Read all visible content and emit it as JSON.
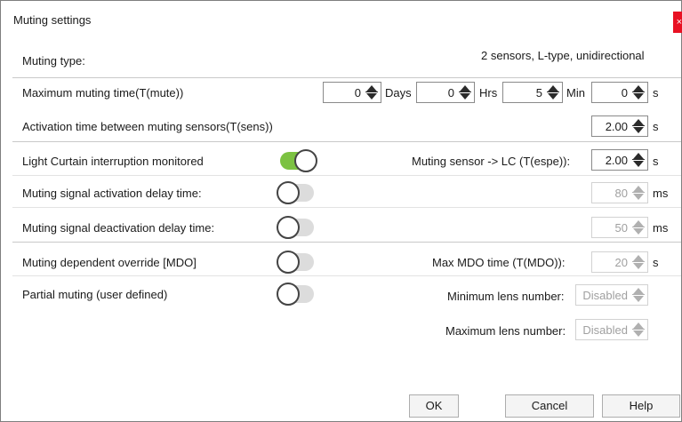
{
  "window": {
    "title": "Muting settings",
    "close_glyph": "×"
  },
  "muting_type": {
    "label": "Muting type:",
    "value": "2 sensors, L-type, unidirectional"
  },
  "max_muting_time": {
    "label": "Maximum muting time(T(mute))",
    "days": {
      "value": "0",
      "unit": "Days"
    },
    "hrs": {
      "value": "0",
      "unit": "Hrs"
    },
    "min": {
      "value": "5",
      "unit": "Min"
    },
    "s": {
      "value": "0",
      "unit": "s"
    }
  },
  "activation_time": {
    "label": "Activation time between muting sensors(T(sens))",
    "value": "2.00",
    "unit": "s"
  },
  "lc_interruption": {
    "label": "Light Curtain interruption monitored",
    "toggle_on": true,
    "sensor_label": "Muting sensor -> LC (T(espe)):",
    "value": "2.00",
    "unit": "s"
  },
  "activation_delay": {
    "label": "Muting signal activation delay time:",
    "toggle_on": false,
    "value": "80",
    "unit": "ms"
  },
  "deactivation_delay": {
    "label": "Muting signal deactivation delay time:",
    "toggle_on": false,
    "value": "50",
    "unit": "ms"
  },
  "mdo": {
    "label": "Muting dependent override [MDO]",
    "toggle_on": false,
    "time_label": "Max MDO time (T(MDO)):",
    "value": "20",
    "unit": "s"
  },
  "partial_muting": {
    "label": "Partial muting (user defined)",
    "toggle_on": false,
    "min_label": "Minimum lens number:",
    "min_value": "Disabled",
    "max_label": "Maximum lens number:",
    "max_value": "Disabled"
  },
  "buttons": {
    "ok": "OK",
    "cancel": "Cancel",
    "help": "Help"
  },
  "colors": {
    "accent_green": "#7cc242",
    "close_red": "#e81123"
  }
}
